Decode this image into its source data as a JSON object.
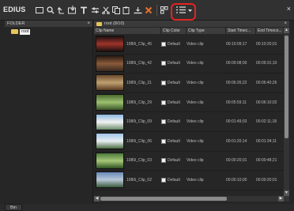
{
  "app": {
    "logo": "EDIUS",
    "close_glyph": "×"
  },
  "toolbar": {
    "buttons": [
      {
        "name": "new-sequence-icon"
      },
      {
        "name": "search-icon"
      },
      {
        "name": "up-folder-icon"
      },
      {
        "name": "import-icon"
      },
      {
        "name": "title-icon"
      },
      {
        "name": "properties-icon"
      },
      {
        "name": "cut-icon"
      },
      {
        "name": "copy-icon"
      },
      {
        "name": "paste-icon"
      },
      {
        "name": "add-to-timeline-icon"
      },
      {
        "name": "delete-icon"
      },
      {
        "name": "change-view-icon"
      },
      {
        "name": "view-dropdown-icon"
      }
    ],
    "highlight_color": "#e32323"
  },
  "folder_panel": {
    "title": "FOLDER",
    "close": "×",
    "root_label": "root"
  },
  "clip_panel": {
    "path_label": "root (8/10)",
    "close": "×",
    "columns": [
      "Clip Name",
      "Clip Color",
      "Clip Type",
      "Start Timec...",
      "End Timeco..."
    ],
    "rows": [
      {
        "name": "1080i_Clip_45",
        "color": "Default",
        "type": "Video clip",
        "start": "00:10:09;17",
        "end": "00:10:20;01",
        "thumb": [
          "#1a1010",
          "#a0342a",
          "#1a1010"
        ]
      },
      {
        "name": "1080i_Clip_42",
        "color": "Default",
        "type": "Video clip",
        "start": "00:09:08;00",
        "end": "00:09:31;10",
        "thumb": [
          "#2a1c14",
          "#8a5a3a",
          "#3a2a20"
        ]
      },
      {
        "name": "1080i_Clip_31",
        "color": "Default",
        "type": "Video clip",
        "start": "00:06:26;22",
        "end": "00:06:40;26",
        "thumb": [
          "#6a4a2c",
          "#c0a070",
          "#5a3c24"
        ]
      },
      {
        "name": "1080i_Clip_29",
        "color": "Default",
        "type": "Video clip",
        "start": "00:05:59;11",
        "end": "00:06:10;02",
        "thumb": [
          "#4c6a30",
          "#9cc070",
          "#3a5428"
        ]
      },
      {
        "name": "1080i_Clip_09",
        "color": "Default",
        "type": "Video clip",
        "start": "00:01:49;03",
        "end": "00:02:11;18",
        "thumb": [
          "#8cb8e0",
          "#f2f2f2",
          "#6a8a6a"
        ]
      },
      {
        "name": "1080i_Clip_06",
        "color": "Default",
        "type": "Video clip",
        "start": "00:01:20;14",
        "end": "00:01:34;11",
        "thumb": [
          "#a0c4e8",
          "#e8eef2",
          "#4a6a40"
        ]
      },
      {
        "name": "1080i_Clip_03",
        "color": "Default",
        "type": "Video clip",
        "start": "00:00:20;01",
        "end": "00:00:48;21",
        "thumb": [
          "#4a7a3a",
          "#a8c878",
          "#2e5222"
        ]
      },
      {
        "name": "1080i_Clip_02",
        "color": "Default",
        "type": "Video clip",
        "start": "00:00:10;00",
        "end": "00:00:20;01",
        "thumb": [
          "#6a8ab8",
          "#b8c8d8",
          "#3a5a3a"
        ]
      }
    ]
  },
  "bottom_tab": {
    "label": "Bin"
  }
}
